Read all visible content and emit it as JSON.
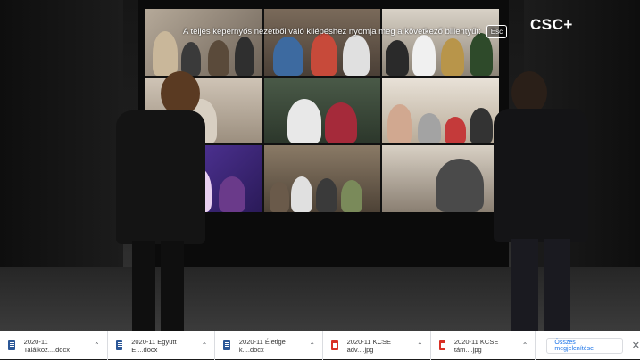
{
  "video": {
    "fullscreen_notice": "A teljes képernyős nézetből való kilépéshez nyomja meg a következő billentyűt:",
    "esc_key": "Esc",
    "logo": "CSC+"
  },
  "download_bar": {
    "items": [
      {
        "name": "2020-11 Találkoz....docx",
        "type": "word"
      },
      {
        "name": "2020-11 Együtt E....docx",
        "type": "word"
      },
      {
        "name": "2020-11 Életige k....docx",
        "type": "word"
      },
      {
        "name": "2020-11 KCSE adv....jpg",
        "type": "jpg"
      },
      {
        "name": "2020-11 KCSE tám....jpg",
        "type": "jpg"
      }
    ],
    "chevron_icon": "chevron-up-icon",
    "show_all_label": "Összes megjelenítése",
    "close_icon": "close-icon"
  }
}
